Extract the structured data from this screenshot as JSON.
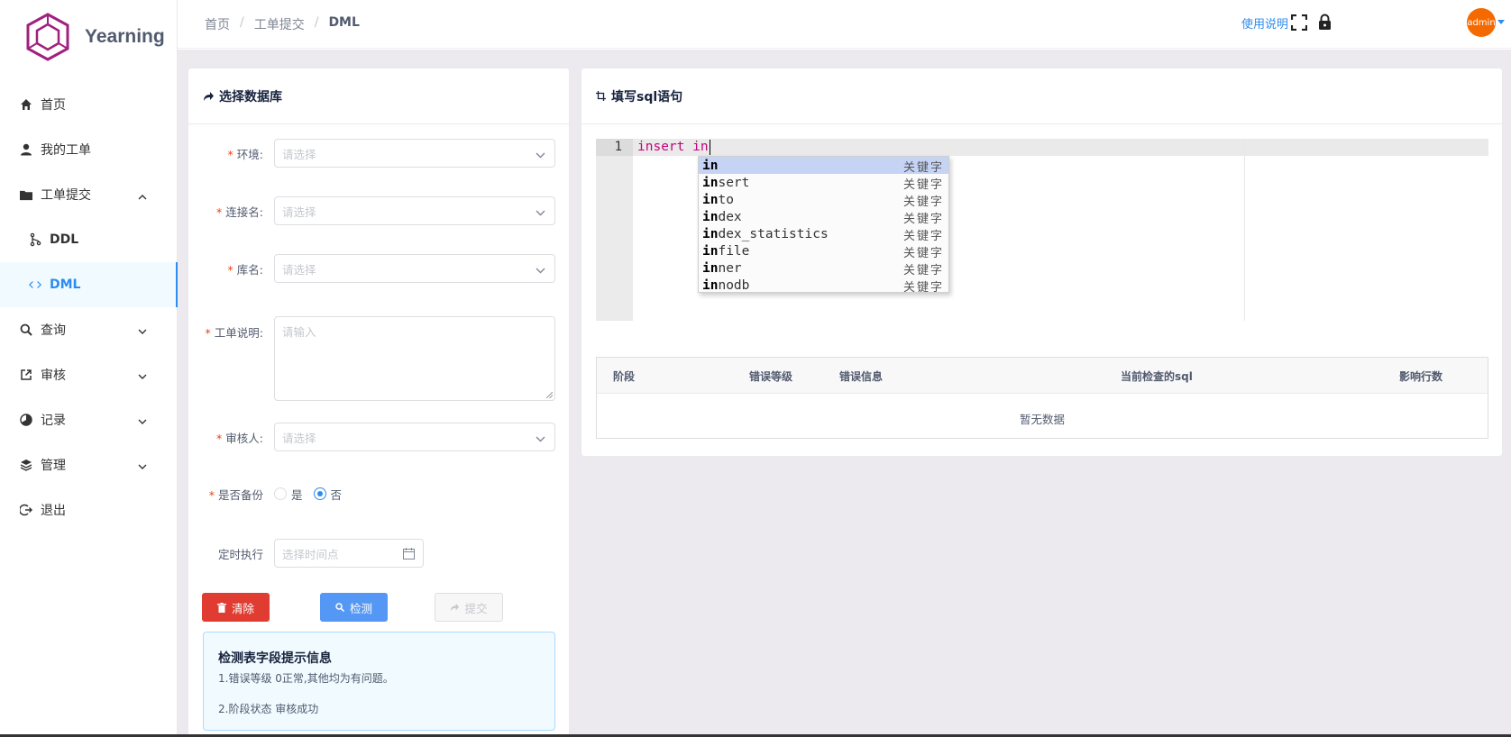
{
  "app": {
    "name": "Yearning"
  },
  "sidebar": {
    "items": [
      {
        "label": "首页",
        "icon": "home-icon"
      },
      {
        "label": "我的工单",
        "icon": "user-icon"
      },
      {
        "label": "工单提交",
        "icon": "folder-icon",
        "expanded": true
      },
      {
        "label": "DDL",
        "icon": "branch-icon"
      },
      {
        "label": "DML",
        "icon": "code-icon",
        "active": true
      },
      {
        "label": "查询",
        "icon": "search-icon"
      },
      {
        "label": "审核",
        "icon": "external-link-icon"
      },
      {
        "label": "记录",
        "icon": "pie-chart-icon"
      },
      {
        "label": "管理",
        "icon": "layers-icon"
      },
      {
        "label": "退出",
        "icon": "logout-icon"
      }
    ]
  },
  "header": {
    "breadcrumb": [
      "首页",
      "工单提交",
      "DML"
    ],
    "help_label": "使用说明",
    "avatar_text": "admin"
  },
  "left_card": {
    "title": "选择数据库",
    "fields": {
      "env": {
        "label": "环境:",
        "placeholder": "请选择"
      },
      "conn": {
        "label": "连接名:",
        "placeholder": "请选择"
      },
      "db": {
        "label": "库名:",
        "placeholder": "请选择"
      },
      "desc": {
        "label": "工单说明:",
        "placeholder": "请输入"
      },
      "reviewer": {
        "label": "审核人:",
        "placeholder": "请选择"
      },
      "backup": {
        "label": "是否备份",
        "options": [
          "是",
          "否"
        ],
        "selected": "否"
      },
      "schedule": {
        "label": "定时执行",
        "placeholder": "选择时间点"
      }
    },
    "buttons": {
      "clear": "清除",
      "check": "检测",
      "submit": "提交"
    },
    "info": {
      "title": "检测表字段提示信息",
      "line1": "1.错误等级 0正常,其他均为有问题。",
      "line2": "2.阶段状态 审核成功"
    }
  },
  "right_card": {
    "title": "填写sql语句",
    "editor": {
      "line_number": "1",
      "code": "insert in"
    },
    "autocomplete": {
      "typed": "in",
      "meta": "关键字",
      "items": [
        "in",
        "insert",
        "into",
        "index",
        "index_statistics",
        "infile",
        "inner",
        "innodb"
      ]
    },
    "table": {
      "columns": [
        "阶段",
        "错误等级",
        "错误信息",
        "当前检查的sql",
        "影响行数"
      ],
      "empty_text": "暂无数据"
    }
  },
  "colors": {
    "primary": "#2d8cf0",
    "danger": "#e03c31",
    "logo": "#a0217f",
    "avatar": "#f56a00",
    "keyword": "#c7007b"
  }
}
